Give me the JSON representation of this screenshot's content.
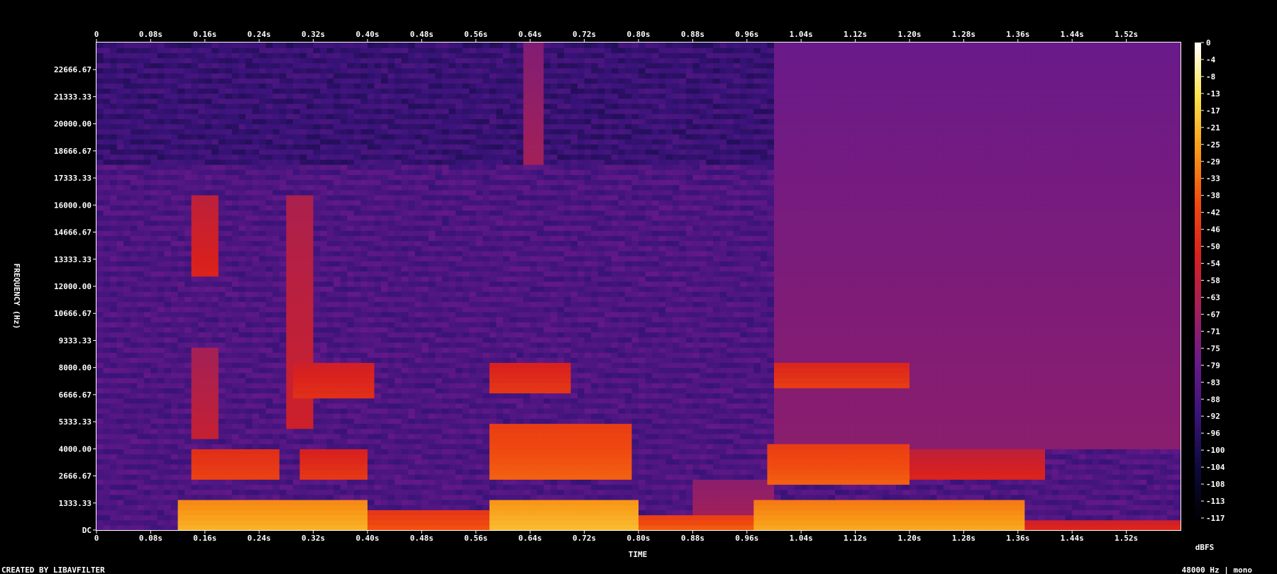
{
  "chart_data": {
    "type": "heatmap",
    "title": "",
    "xlabel": "TIME",
    "ylabel": "FREQUENCY (Hz)",
    "xlim": [
      0,
      1.6
    ],
    "ylim": [
      0,
      24000
    ],
    "x_ticks": [
      "0",
      "0.08s",
      "0.16s",
      "0.24s",
      "0.32s",
      "0.40s",
      "0.48s",
      "0.56s",
      "0.64s",
      "0.72s",
      "0.80s",
      "0.88s",
      "0.96s",
      "1.04s",
      "1.12s",
      "1.20s",
      "1.28s",
      "1.36s",
      "1.44s",
      "1.52s"
    ],
    "x_tick_values": [
      0,
      0.08,
      0.16,
      0.24,
      0.32,
      0.4,
      0.48,
      0.56,
      0.64,
      0.72,
      0.8,
      0.88,
      0.96,
      1.04,
      1.12,
      1.2,
      1.28,
      1.36,
      1.44,
      1.52
    ],
    "y_ticks": [
      "DC",
      "1333.33",
      "2666.67",
      "4000.00",
      "5333.33",
      "6666.67",
      "8000.00",
      "9333.33",
      "10666.67",
      "12000.00",
      "13333.33",
      "14666.67",
      "16000.00",
      "17333.33",
      "18666.67",
      "20000.00",
      "21333.33",
      "22666.67"
    ],
    "y_tick_values": [
      0,
      1333.33,
      2666.67,
      4000,
      5333.33,
      6666.67,
      8000,
      9333.33,
      10666.67,
      12000,
      13333.33,
      14666.67,
      16000,
      17333.33,
      18666.67,
      20000,
      21333.33,
      22666.67
    ],
    "colorbar": {
      "label": "dBFS",
      "ticks": [
        "0",
        "-4",
        "-8",
        "-13",
        "-17",
        "-21",
        "-25",
        "-29",
        "-33",
        "-38",
        "-42",
        "-46",
        "-50",
        "-54",
        "-58",
        "-63",
        "-67",
        "-71",
        "-75",
        "-79",
        "-83",
        "-88",
        "-92",
        "-96",
        "-100",
        "-104",
        "-108",
        "-113",
        "-117"
      ],
      "range": [
        -120,
        0
      ],
      "colors": [
        "#000000",
        "#0d0a3a",
        "#3a137a",
        "#6a1a8a",
        "#a0205a",
        "#d8201e",
        "#f04a10",
        "#f89a18",
        "#fbe24c",
        "#ffffff"
      ]
    },
    "background_db": -88,
    "energy_regions": [
      {
        "t0": 0.125,
        "t1": 0.4,
        "f0": 0,
        "f1": 1500,
        "db": -22
      },
      {
        "t0": 0.4,
        "t1": 0.58,
        "f0": 0,
        "f1": 900,
        "db": -38
      },
      {
        "t0": 0.58,
        "t1": 0.8,
        "f0": 0,
        "f1": 1500,
        "db": -20
      },
      {
        "t0": 0.8,
        "t1": 0.97,
        "f0": 0,
        "f1": 700,
        "db": -36
      },
      {
        "t0": 0.97,
        "t1": 1.37,
        "f0": 0,
        "f1": 1400,
        "db": -24
      },
      {
        "t0": 1.37,
        "t1": 1.6,
        "f0": 0,
        "f1": 600,
        "db": -50
      },
      {
        "t0": 0.14,
        "t1": 0.27,
        "f0": 2400,
        "f1": 4100,
        "db": -42
      },
      {
        "t0": 0.3,
        "t1": 0.4,
        "f0": 2600,
        "f1": 4000,
        "db": -46
      },
      {
        "t0": 0.58,
        "t1": 0.79,
        "f0": 2500,
        "f1": 5200,
        "db": -36
      },
      {
        "t0": 0.99,
        "t1": 1.2,
        "f0": 2200,
        "f1": 4200,
        "db": -36
      },
      {
        "t0": 1.2,
        "t1": 1.4,
        "f0": 2600,
        "f1": 4000,
        "db": -52
      },
      {
        "t0": 0.29,
        "t1": 0.41,
        "f0": 6500,
        "f1": 8300,
        "db": -48
      },
      {
        "t0": 0.58,
        "t1": 0.7,
        "f0": 6800,
        "f1": 8300,
        "db": -46
      },
      {
        "t0": 1.0,
        "t1": 1.2,
        "f0": 7000,
        "f1": 8200,
        "db": -44
      },
      {
        "t0": 0.14,
        "t1": 0.18,
        "f0": 12500,
        "f1": 16500,
        "db": -52
      },
      {
        "t0": 0.28,
        "t1": 0.32,
        "f0": 5000,
        "f1": 16500,
        "db": -56
      },
      {
        "t0": 0.14,
        "t1": 0.18,
        "f0": 4500,
        "f1": 9000,
        "db": -58
      },
      {
        "t0": 0.63,
        "t1": 0.66,
        "f0": 18000,
        "f1": 24000,
        "db": -66
      },
      {
        "t0": 1.0,
        "t1": 1.6,
        "f0": 4000,
        "f1": 24000,
        "db": -72
      },
      {
        "t0": 0.88,
        "t1": 1.0,
        "f0": 0,
        "f1": 2500,
        "db": -64
      }
    ]
  },
  "footer": {
    "left": "CREATED BY LIBAVFILTER",
    "right": "48000 Hz | mono"
  }
}
